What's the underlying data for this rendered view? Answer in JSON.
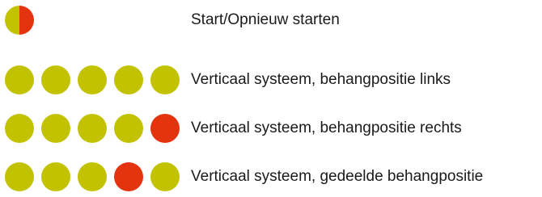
{
  "legend": {
    "rows": [
      {
        "label": "Start/Opnieuw starten",
        "dots": [
          "split"
        ]
      },
      {
        "label": "Verticaal systeem, behangpositie links",
        "dots": [
          "green",
          "green",
          "green",
          "green",
          "green"
        ]
      },
      {
        "label": "Verticaal systeem, behangpositie rechts",
        "dots": [
          "green",
          "green",
          "green",
          "green",
          "red"
        ]
      },
      {
        "label": "Verticaal systeem, gedeelde behangpositie",
        "dots": [
          "green",
          "green",
          "green",
          "red",
          "green"
        ]
      }
    ]
  },
  "colors": {
    "green": "#c2c200",
    "red": "#e4330f",
    "text": "#1a1a1a"
  }
}
